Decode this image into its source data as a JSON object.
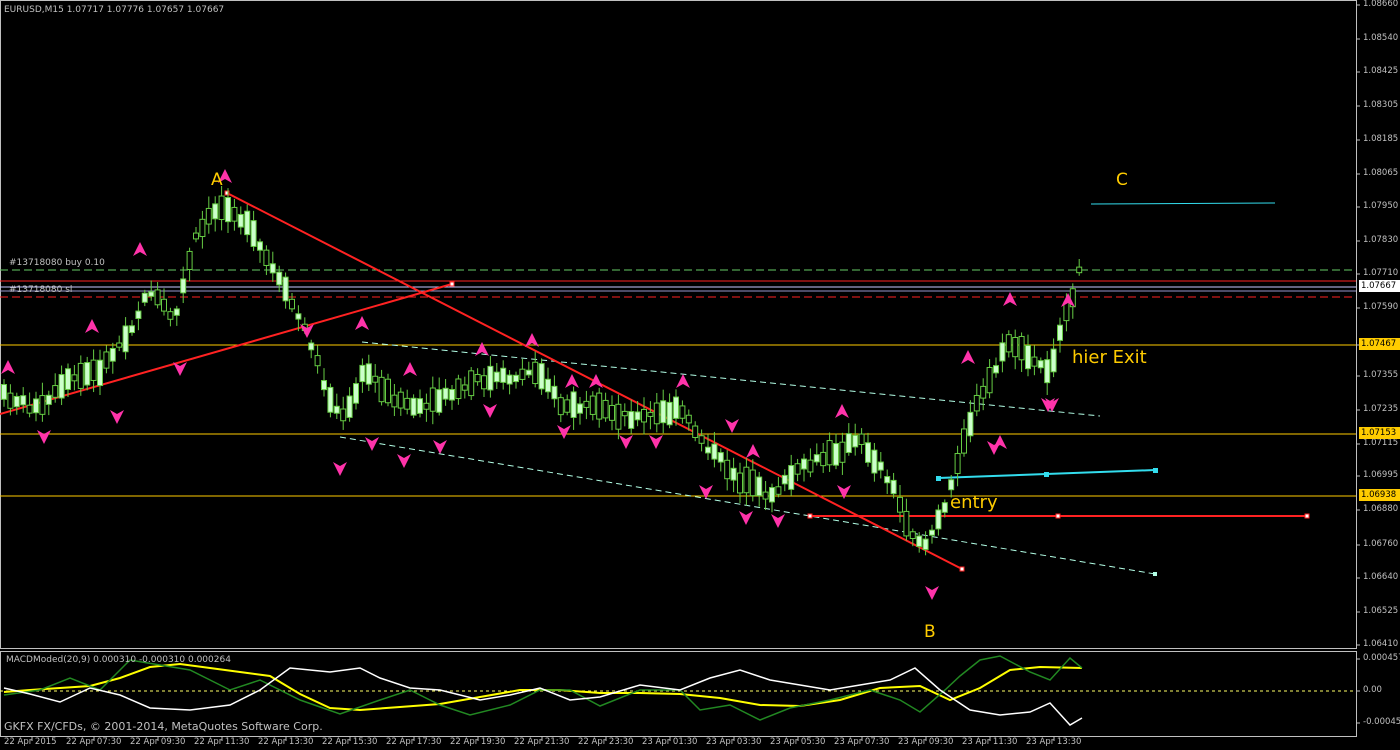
{
  "window": {
    "symbol_header": "EURUSD,M15  1.07717 1.07776 1.07657 1.07667"
  },
  "colors": {
    "background": "#000000",
    "axis": "#c0c0c0",
    "bull_candle": "#ccffcc",
    "bear_candle": "#000000",
    "candle_wick": "#66cc44",
    "arrow_up": "#ff3399",
    "arrow_down": "#ff3399",
    "level_line": "#ffcc00",
    "trend_red": "#ff2222",
    "channel_aqua": "#b3ffe6",
    "cyan_line": "#33ddee",
    "label_text": "#ffcc00",
    "macd_white": "#ffffff",
    "macd_green": "#228822",
    "macd_yellow": "#ffff00"
  },
  "orders": {
    "buy_label": "#13718080 buy 0.10",
    "sl_label": "#13718080 sl"
  },
  "annotations": {
    "A": "A",
    "B": "B",
    "C": "C",
    "entry": "entry",
    "exit": "hier Exit"
  },
  "price_axis": {
    "ticks": [
      "1.08660",
      "1.08540",
      "1.08425",
      "1.08305",
      "1.08185",
      "1.08065",
      "1.07950",
      "1.07830",
      "1.07710",
      "1.07590",
      "1.07475",
      "1.07355",
      "1.07235",
      "1.07115",
      "1.06995",
      "1.06880",
      "1.06760",
      "1.06640",
      "1.06525",
      "1.06410"
    ],
    "current_price": "1.07667",
    "level_1": "1.07467",
    "level_2": "1.07153",
    "level_3": "1.06938"
  },
  "macd": {
    "title": "MACDModed(20,9) 0.000310 -0.000310 0.000264",
    "ticks": [
      "0.00045753",
      "0.00",
      "-0.00045753"
    ]
  },
  "time_axis": {
    "labels": [
      "22 Apr 2015",
      "22 Apr 07:30",
      "22 Apr 09:30",
      "22 Apr 11:30",
      "22 Apr 13:30",
      "22 Apr 15:30",
      "22 Apr 17:30",
      "22 Apr 19:30",
      "22 Apr 21:30",
      "22 Apr 23:30",
      "23 Apr 01:30",
      "23 Apr 03:30",
      "23 Apr 05:30",
      "23 Apr 07:30",
      "23 Apr 09:30",
      "23 Apr 11:30",
      "23 Apr 13:30"
    ]
  },
  "copyright": "GKFX FX/CFDs, © 2001-2014, MetaQuotes Software Corp."
}
